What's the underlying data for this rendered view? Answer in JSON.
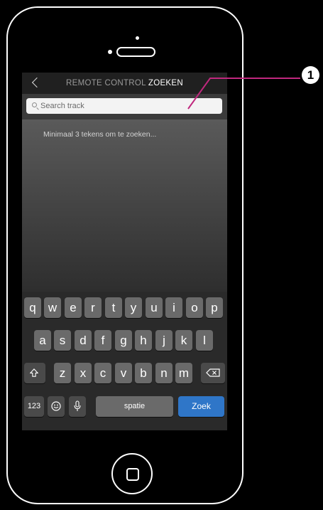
{
  "nav": {
    "title_prefix": "REMOTE CONTROL",
    "title_suffix": "ZOEKEN"
  },
  "search": {
    "placeholder": "Search track"
  },
  "results": {
    "hint": "Minimaal 3 tekens om te zoeken..."
  },
  "keyboard": {
    "row1": [
      "q",
      "w",
      "e",
      "r",
      "t",
      "y",
      "u",
      "i",
      "o",
      "p"
    ],
    "row2": [
      "a",
      "s",
      "d",
      "f",
      "g",
      "h",
      "j",
      "k",
      "l"
    ],
    "row3": [
      "z",
      "x",
      "c",
      "v",
      "b",
      "n",
      "m"
    ],
    "numbers_label": "123",
    "space_label": "spatie",
    "action_label": "Zoek",
    "icons": {
      "shift": "shift-icon",
      "backspace": "backspace-icon",
      "emoji": "emoji-icon",
      "microphone": "microphone-icon"
    }
  },
  "annotation": {
    "callout_number": "1"
  },
  "colors": {
    "accent": "#2f76c8",
    "callout_line": "#c0287e"
  }
}
